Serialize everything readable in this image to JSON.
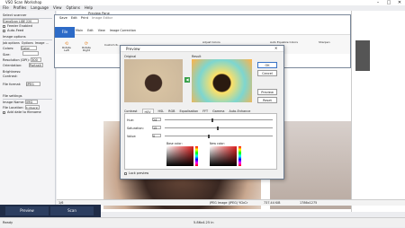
{
  "app": {
    "title": "VSO Scan Workshop",
    "preview_title": "Preview Pane",
    "editor_title": "Image Editor"
  },
  "menu": [
    "File",
    "Profiles",
    "Language",
    "View",
    "Options",
    "Help"
  ],
  "left": {
    "select_scanner": "Select scanner",
    "scanner_name": "CanoScan LiDE 220",
    "feeder_enabled": "Feeder Enabled",
    "auto_feed": "Auto-Feed",
    "image_options": "Image options",
    "tabs": [
      "Job options",
      "Options",
      "Image ..."
    ],
    "colors_label": "Colors:",
    "colors_value": "Color",
    "size_label": "Size:",
    "resolution_label": "Resolution (DPI):",
    "resolution_value": "300",
    "orientation_label": "Orientation:",
    "orientation_value": "Portrait",
    "brightness_label": "Brightness:",
    "contrast_label": "Contrast:",
    "file_format_label": "File format:",
    "file_format_value": "JPEG",
    "file_settings": "File settings",
    "image_name_label": "Image Name:",
    "image_name_value": "IMG",
    "file_location_label": "File Location:",
    "file_location_value": "C:\\Users\\",
    "add_date": "Add date to filename"
  },
  "editor": {
    "quick_save": "Save",
    "quick_edit": "Edit",
    "quick_print": "Print",
    "tabs": [
      "File",
      "Main",
      "Edit",
      "View",
      "Image Correction"
    ],
    "rotate_left": "Rotate Left",
    "rotate_right": "Rotate Right",
    "adjust_colors": "Adjust Colors",
    "auto_equalize": "Auto Equalize Colors",
    "sharpen": "Sharpen",
    "custom": "Custom R...",
    "sample_rotate": "Sample Rotat..."
  },
  "dialog": {
    "title": "Preview",
    "original": "Original",
    "result": "Result",
    "ok": "OK",
    "cancel": "Cancel",
    "preview": "Preview",
    "reset": "Reset",
    "tabs": [
      "Contrast",
      "HSV",
      "HSL",
      "RGB",
      "Equalisation",
      "FFT",
      "Gamma",
      "Auto-Enhance"
    ],
    "hue_label": "Hue:",
    "hue_value": "24",
    "saturation_label": "Saturation:",
    "saturation_value": "15",
    "value_label": "Value:",
    "value_value": "0",
    "base_color": "Base color:",
    "new_color": "New color:",
    "lock_preview": "Lock preview"
  },
  "bottom": {
    "preview_btn": "Preview",
    "scan_btn": "Scan",
    "page": "1/6",
    "image_info": "JPEG Image (JPEG) YCbCr",
    "file_size": "737.44 KiB",
    "dims": "1786x1275",
    "status": "Ready",
    "coords": "5.86x4.25 in"
  },
  "colors": {
    "accent": "#2d6bc7",
    "dark_bar": "#1f2c47"
  }
}
